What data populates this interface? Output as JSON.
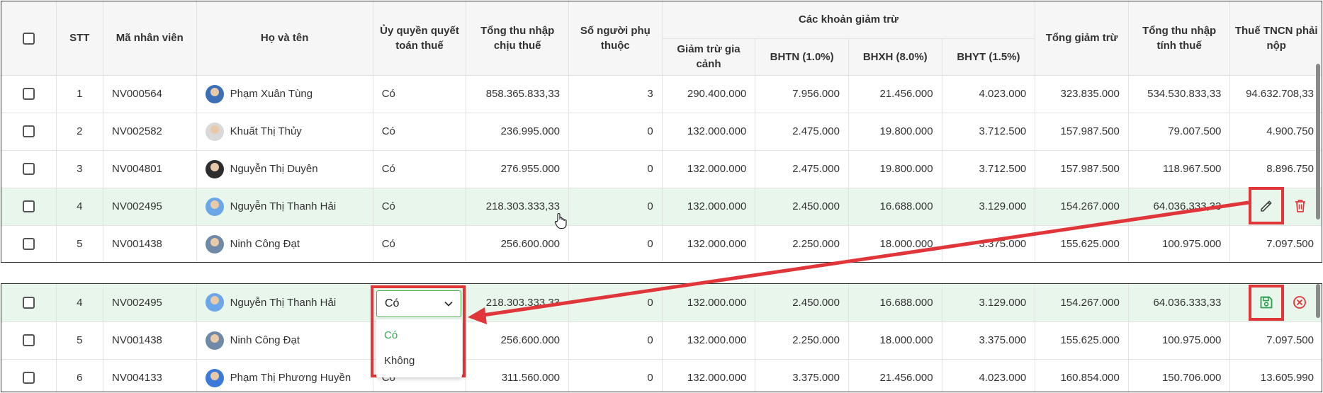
{
  "headers": {
    "stt": "STT",
    "ma_nv": "Mã nhân viên",
    "ho_ten": "Họ và tên",
    "uy_quyen": "Ủy quyền quyết toán thuế",
    "tong_thu_nhap": "Tổng thu nhập chịu thuế",
    "so_nguoi": "Số người phụ thuộc",
    "cac_khoan": "Các khoản giảm trừ",
    "giam_tru_gia_canh": "Giảm trừ gia cảnh",
    "bhtn": "BHTN (1.0%)",
    "bhxh": "BHXH (8.0%)",
    "bhyt": "BHYT (1.5%)",
    "tong_giam_tru": "Tổng giảm trừ",
    "tong_tnt": "Tổng thu nhập tính thuế",
    "thue": "Thuế TNCN phải nộp"
  },
  "rows1": [
    {
      "stt": "1",
      "ma": "NV000564",
      "ten": "Phạm Xuân Tùng",
      "uq": "Có",
      "tn": "858.365.833,33",
      "sn": "3",
      "gc": "290.400.000",
      "bhtn": "7.956.000",
      "bhxh": "21.456.000",
      "bhyt": "4.023.000",
      "tgt": "323.835.000",
      "tnt": "534.530.833,33",
      "thue": "94.632.708,33"
    },
    {
      "stt": "2",
      "ma": "NV002582",
      "ten": "Khuất Thị Thủy",
      "uq": "Có",
      "tn": "236.995.000",
      "sn": "0",
      "gc": "132.000.000",
      "bhtn": "2.475.000",
      "bhxh": "19.800.000",
      "bhyt": "3.712.500",
      "tgt": "157.987.500",
      "tnt": "79.007.500",
      "thue": "4.900.750"
    },
    {
      "stt": "3",
      "ma": "NV004801",
      "ten": "Nguyễn Thị Duyên",
      "uq": "Có",
      "tn": "276.955.000",
      "sn": "0",
      "gc": "132.000.000",
      "bhtn": "2.475.000",
      "bhxh": "19.800.000",
      "bhyt": "3.712.500",
      "tgt": "157.987.500",
      "tnt": "118.967.500",
      "thue": "8.896.750"
    },
    {
      "stt": "4",
      "ma": "NV002495",
      "ten": "Nguyễn Thị Thanh Hải",
      "uq": "Có",
      "tn": "218.303.333,33",
      "sn": "0",
      "gc": "132.000.000",
      "bhtn": "2.450.000",
      "bhxh": "16.688.000",
      "bhyt": "3.129.000",
      "tgt": "154.267.000",
      "tnt": "64.036.333,33",
      "thue": ""
    },
    {
      "stt": "5",
      "ma": "NV001438",
      "ten": "Ninh Công Đạt",
      "uq": "Có",
      "tn": "256.600.000",
      "sn": "0",
      "gc": "132.000.000",
      "bhtn": "2.250.000",
      "bhxh": "18.000.000",
      "bhyt": "3.375.000",
      "tgt": "155.625.000",
      "tnt": "100.975.000",
      "thue": "7.097.500"
    }
  ],
  "rows2": [
    {
      "stt": "4",
      "ma": "NV002495",
      "ten": "Nguyễn Thị Thanh Hải",
      "uq": "",
      "tn": "218.303.333,33",
      "sn": "0",
      "gc": "132.000.000",
      "bhtn": "2.450.000",
      "bhxh": "16.688.000",
      "bhyt": "3.129.000",
      "tgt": "154.267.000",
      "tnt": "64.036.333,33",
      "thue": ""
    },
    {
      "stt": "5",
      "ma": "NV001438",
      "ten": "Ninh Công Đạt",
      "uq": "",
      "tn": "256.600.000",
      "sn": "0",
      "gc": "132.000.000",
      "bhtn": "2.250.000",
      "bhxh": "18.000.000",
      "bhyt": "3.375.000",
      "tgt": "155.625.000",
      "tnt": "100.975.000",
      "thue": "7.097.500"
    },
    {
      "stt": "6",
      "ma": "NV004133",
      "ten": "Phạm Thị Phương Huyền",
      "uq": "Có",
      "tn": "311.560.000",
      "sn": "0",
      "gc": "132.000.000",
      "bhtn": "3.375.000",
      "bhxh": "21.456.000",
      "bhyt": "4.023.000",
      "tgt": "160.854.000",
      "tnt": "150.706.000",
      "thue": "13.605.990"
    }
  ],
  "dropdown": {
    "selected": "Có",
    "options": [
      "Có",
      "Không"
    ]
  },
  "icons": {
    "edit": "pencil-icon",
    "delete": "trash-icon",
    "save": "save-icon",
    "cancel": "close-circle-icon"
  },
  "colors": {
    "highlight_box": "#e0363a",
    "selected_row": "#e8f6ec",
    "save_green": "#2e9e4f",
    "delete_red": "#e0363a"
  }
}
